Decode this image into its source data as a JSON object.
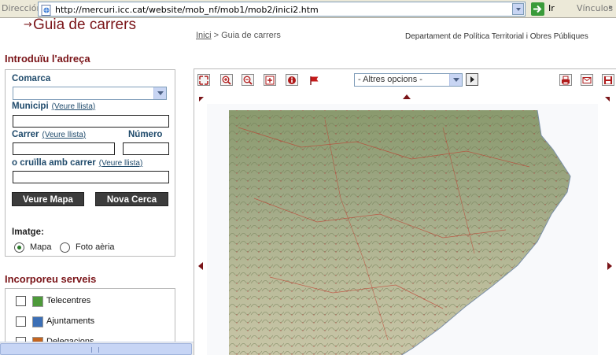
{
  "browser": {
    "address_label": "Dirección",
    "url": "http://mercuri.icc.cat/website/mob_nf/mob1/mob2/inici2.htm",
    "go_label": "Ir",
    "links_label": "Vínculos"
  },
  "header": {
    "title": "Guia de carrers",
    "breadcrumb_home": "Inici",
    "breadcrumb_sep": " > ",
    "breadcrumb_current": "Guia de carrers",
    "department": "Departament de Política Territorial i Obres Públiques"
  },
  "address_form": {
    "section_title": "Introduïu l'adreça",
    "comarca_label": "Comarca",
    "comarca_value": "",
    "municipi_label": "Municipi",
    "municipi_link": "(Veure llista)",
    "municipi_value": "",
    "carrer_label": "Carrer",
    "carrer_link": "(Veure llista)",
    "carrer_value": "",
    "numero_label": "Número",
    "numero_value": "",
    "cruilla_label": "o cruïlla amb carrer",
    "cruilla_link": "(Veure llista)",
    "cruilla_value": "",
    "view_map_button": "Veure Mapa",
    "new_search_button": "Nova Cerca",
    "image_label": "Imatge:",
    "image_options": [
      {
        "label": "Mapa",
        "selected": true
      },
      {
        "label": "Foto aèria",
        "selected": false
      }
    ]
  },
  "services": {
    "section_title": "Incorporeu serveis",
    "items": [
      {
        "label": "Telecentres",
        "checked": false,
        "icon": "telecentre-icon",
        "color": "#4d9a3a"
      },
      {
        "label": "Ajuntaments",
        "checked": false,
        "icon": "townhall-icon",
        "color": "#3b6fb6"
      },
      {
        "label": "Delegacions",
        "checked": false,
        "icon": "delegation-icon",
        "color": "#c4651f"
      }
    ]
  },
  "map_toolbar": {
    "options_select": "- Altres opcions -",
    "tools": [
      "fullextent-icon",
      "zoom-in-icon",
      "zoom-out-icon",
      "pan-icon",
      "info-icon",
      "flag-icon"
    ],
    "right_tools": [
      "print-icon",
      "email-icon",
      "save-icon"
    ]
  },
  "colors": {
    "accent": "#7a1418",
    "label_blue": "#1f4a6b",
    "button_dark": "#3c3c3c"
  }
}
